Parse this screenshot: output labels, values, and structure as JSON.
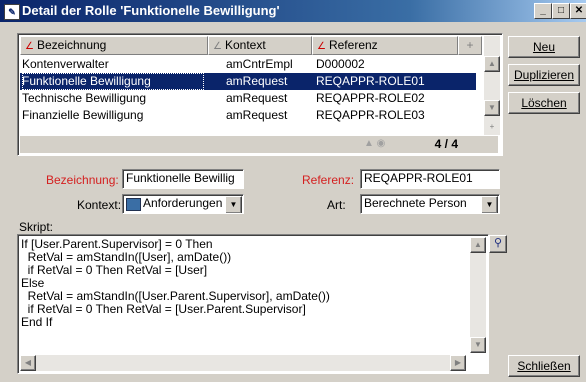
{
  "window": {
    "title": "Detail der Rolle 'Funktionelle Bewilligung'"
  },
  "list": {
    "columns": [
      "Bezeichnung",
      "Kontext",
      "Referenz"
    ],
    "rows": [
      {
        "bezeichnung": "Kontenverwalter",
        "kontext": "amCntrEmpl",
        "referenz": "D000002"
      },
      {
        "bezeichnung": "Funktionelle Bewilligung",
        "kontext": "amRequest",
        "referenz": "REQAPPR-ROLE01"
      },
      {
        "bezeichnung": "Technische Bewilligung",
        "kontext": "amRequest",
        "referenz": "REQAPPR-ROLE02"
      },
      {
        "bezeichnung": "Finanzielle Bewilligung",
        "kontext": "amRequest",
        "referenz": "REQAPPR-ROLE03"
      }
    ],
    "selected_index": 1,
    "counter": "4 / 4"
  },
  "buttons": {
    "new": "Neu",
    "duplicate": "Duplizieren",
    "delete": "Löschen",
    "close": "Schließen"
  },
  "form": {
    "bezeichnung_label": "Bezeichnung:",
    "bezeichnung_value": "Funktionelle Bewillig",
    "referenz_label": "Referenz:",
    "referenz_value": "REQAPPR-ROLE01",
    "kontext_label": "Kontext:",
    "kontext_value": "Anforderungen",
    "art_label": "Art:",
    "art_value": "Berechnete Person",
    "skript_label": "Skript:",
    "skript_lines": [
      "If [User.Parent.Supervisor] = 0 Then",
      "  RetVal = amStandIn([User], amDate())",
      "  if RetVal = 0 Then RetVal = [User]",
      "Else",
      "  RetVal = amStandIn([User.Parent.Supervisor], amDate())",
      "  if RetVal = 0 Then RetVal = [User.Parent.Supervisor]",
      "End If"
    ]
  },
  "colors": {
    "title_gradient_start": "#0a246a",
    "selection": "#0a246a",
    "required_label": "#d42020"
  }
}
